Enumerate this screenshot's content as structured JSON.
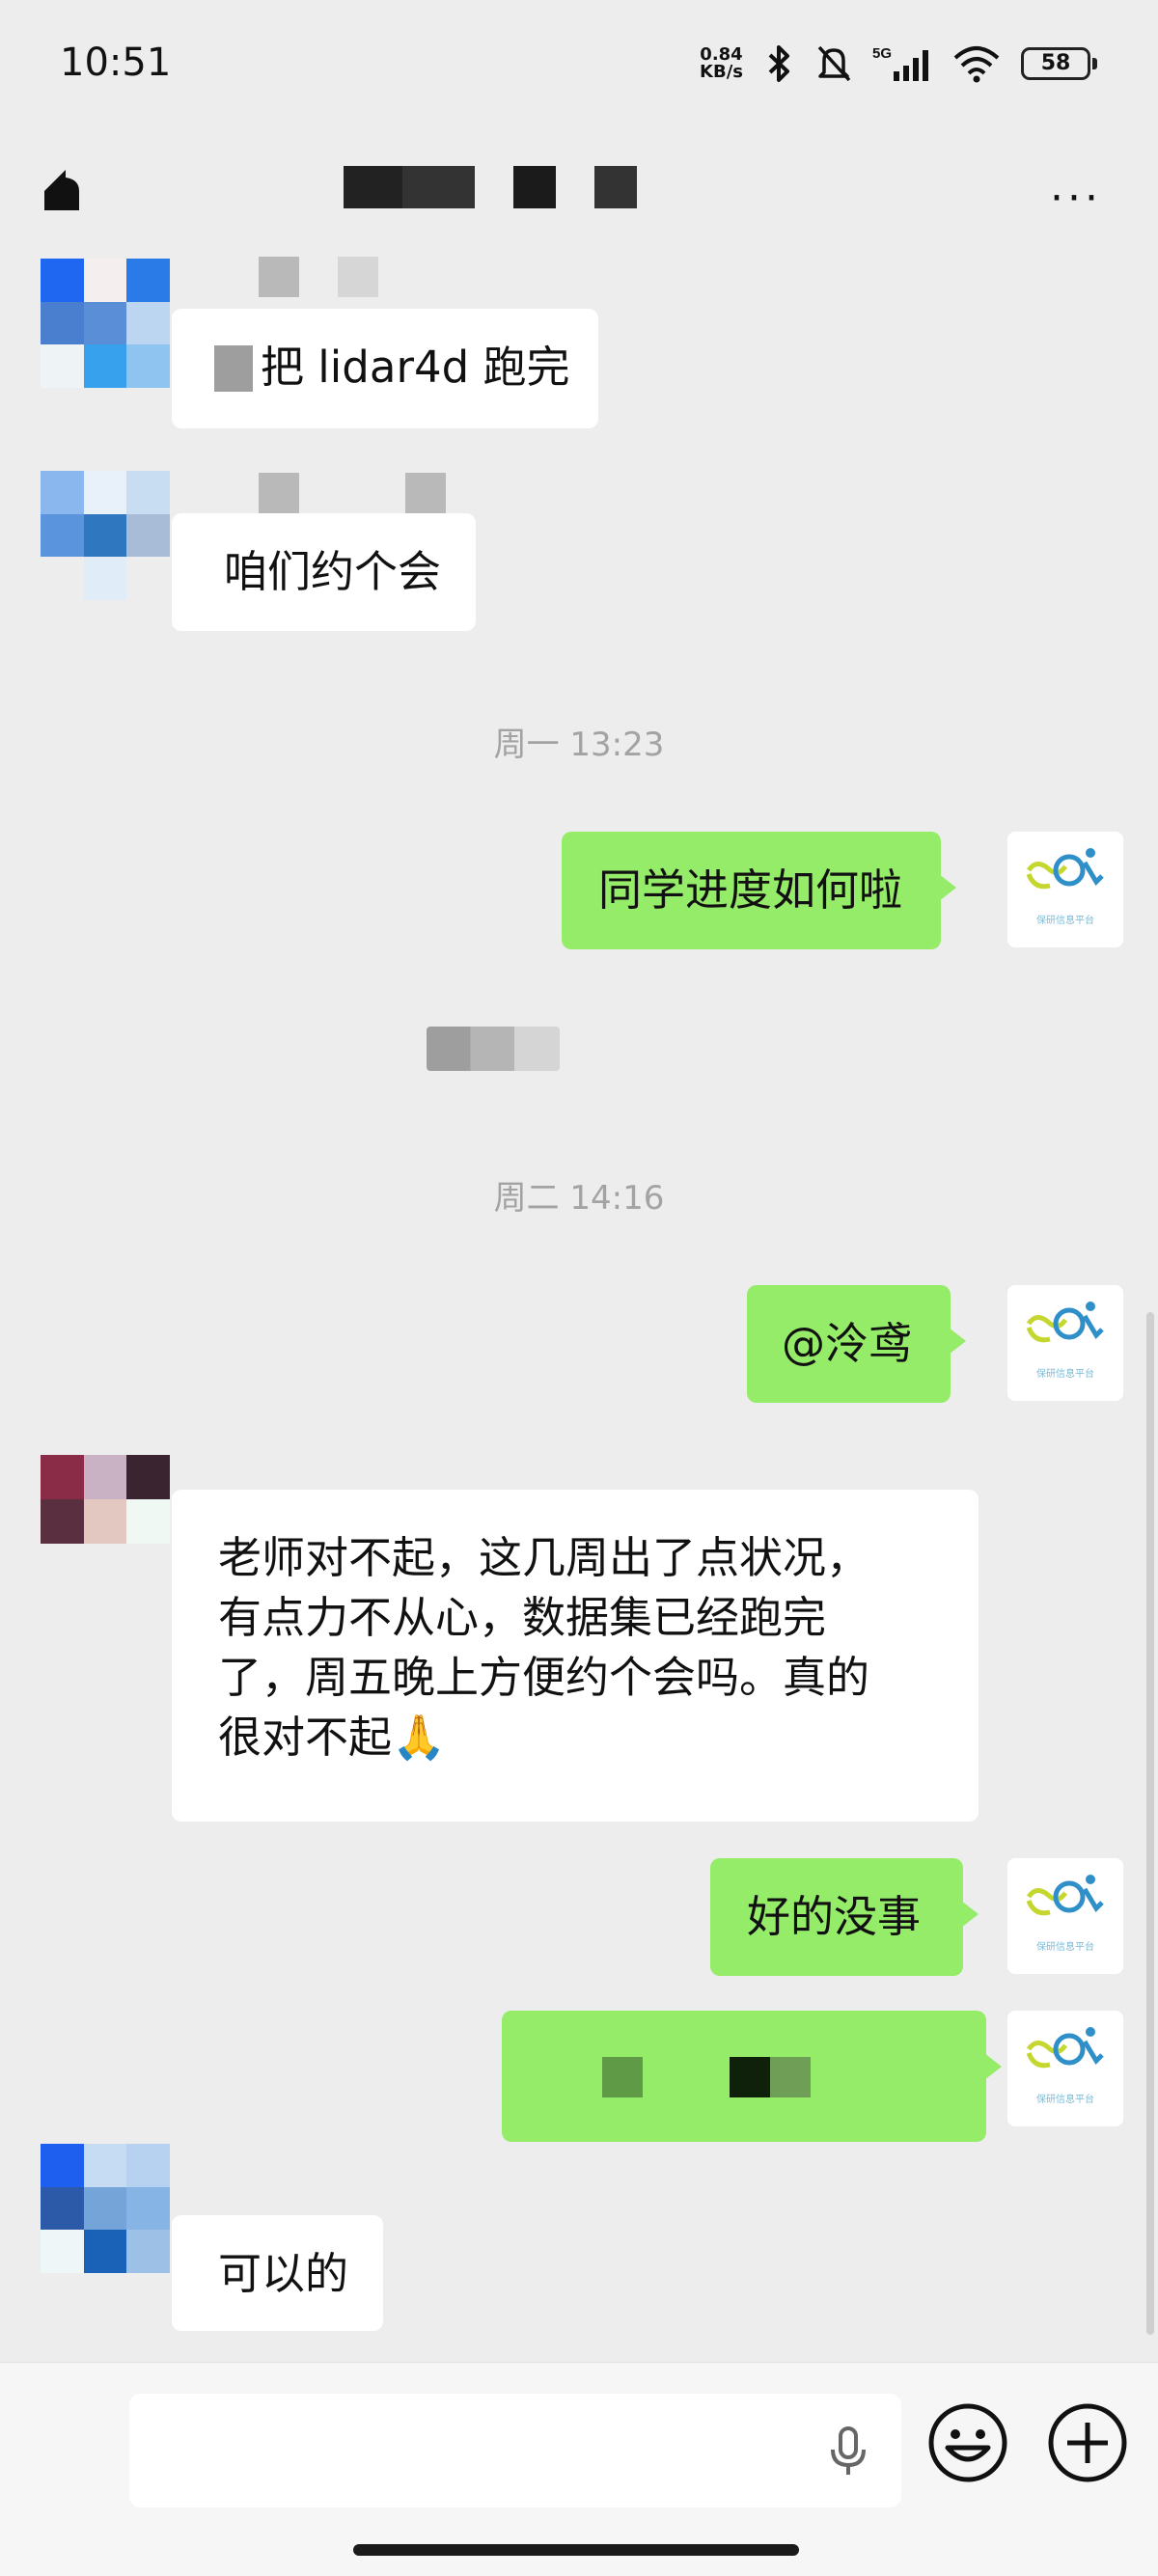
{
  "status_bar": {
    "time": "10:51",
    "net_speed_value": "0.84",
    "net_speed_unit": "KB/s",
    "signal_label": "5G",
    "battery": "58"
  },
  "title_bar": {
    "more_label": "···"
  },
  "messages": [
    {
      "from": "other",
      "text": "把 lidar4d 跑完"
    },
    {
      "from": "other",
      "text": "咱们约个会"
    },
    {
      "type": "timestamp",
      "text": "周一 13:23"
    },
    {
      "from": "self",
      "text": "同学进度如何啦"
    },
    {
      "type": "timestamp",
      "text": "周二 14:16"
    },
    {
      "from": "self",
      "text": "@泠鸢"
    },
    {
      "from": "other",
      "lines": [
        "老师对不起，这几周出了点状况，",
        "有点力不从心，数据集已经跑完",
        "了，周五晚上方便约个会吗。真的",
        "很对不起🙏"
      ]
    },
    {
      "from": "self",
      "text": "好的没事"
    },
    {
      "from": "other",
      "text": "可以的"
    }
  ],
  "self_avatar": {
    "caption": "保研信息平台"
  },
  "colors": {
    "background": "#ededed",
    "bubble_self": "#95ec69",
    "bubble_other": "#ffffff",
    "timestamp": "#a3a3a3"
  },
  "icons": {
    "back": "back-arrow-icon",
    "more": "more-dots-icon",
    "voice": "microphone-icon",
    "emoji": "smiley-icon",
    "add": "plus-circle-icon"
  }
}
